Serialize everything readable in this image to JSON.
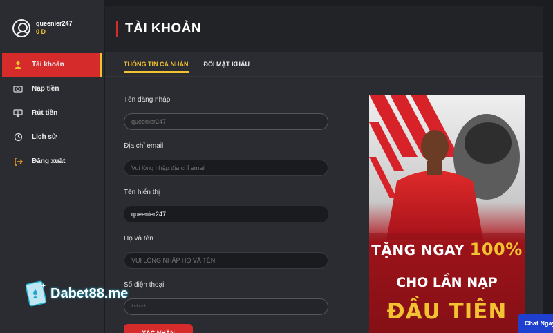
{
  "user": {
    "username": "queenier247",
    "balance": "0 D"
  },
  "sidebar": {
    "items": [
      {
        "label": "Tài khoản",
        "icon": "user-icon"
      },
      {
        "label": "Nạp tiền",
        "icon": "deposit-icon"
      },
      {
        "label": "Rút tiền",
        "icon": "withdraw-icon"
      },
      {
        "label": "Lịch sử",
        "icon": "history-icon"
      },
      {
        "label": "Đăng xuất",
        "icon": "logout-icon"
      }
    ]
  },
  "header": {
    "title": "TÀI KHOẢN"
  },
  "tabs": [
    {
      "label": "THÔNG TIN CÁ NHÂN"
    },
    {
      "label": "ĐỔI MẬT KHẨU"
    }
  ],
  "form": {
    "fields": [
      {
        "label": "Tên đăng nhập",
        "value": "",
        "placeholder": "queenier247"
      },
      {
        "label": "Địa chỉ email",
        "value": "",
        "placeholder": "Vui lòng nhập địa chỉ email"
      },
      {
        "label": "Tên hiển thị",
        "value": "queenier247",
        "placeholder": ""
      },
      {
        "label": "Họ và tên",
        "value": "",
        "placeholder": "VUI LÒNG NHẬP HỌ VÀ TÊN"
      },
      {
        "label": "Số điện thoại",
        "value": "",
        "placeholder": "******"
      }
    ],
    "submit_label": "XÁC NHẬN"
  },
  "banner": {
    "line1_prefix": "TẶNG NGAY ",
    "line1_highlight": "100%",
    "line2": "CHO LẦN NẠP",
    "line3": "ĐẦU TIÊN"
  },
  "watermark": {
    "text": "Dabet88.me"
  },
  "chat": {
    "label": "Chat Ngay"
  },
  "colors": {
    "accent_red": "#d52b2b",
    "accent_yellow": "#f2c230",
    "chat_blue": "#1f3fcf"
  }
}
